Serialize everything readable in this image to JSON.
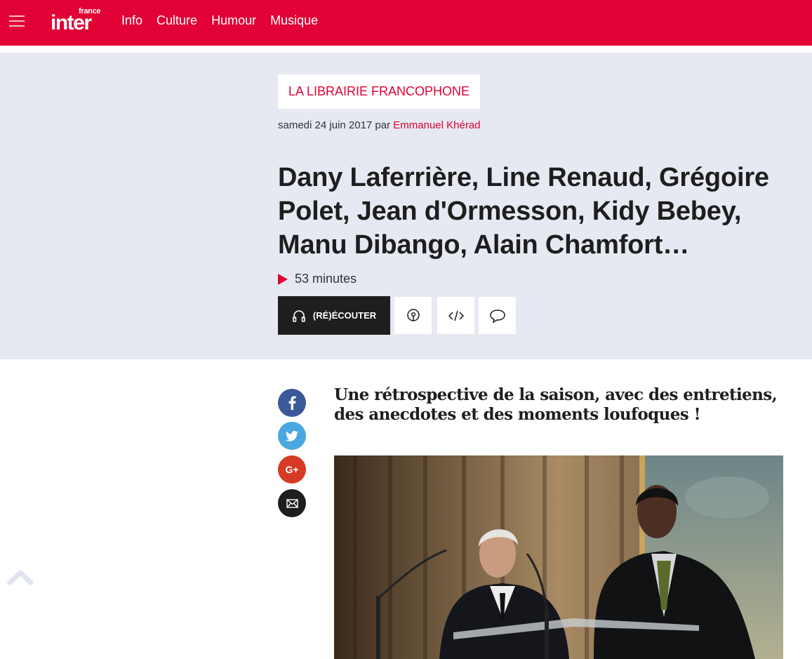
{
  "header": {
    "logo_small": "france",
    "logo_big": "inter",
    "nav": [
      "Info",
      "Culture",
      "Humour",
      "Musique"
    ]
  },
  "article": {
    "kicker": "LA LIBRAIRIE FRANCOPHONE",
    "date_prefix": "samedi 24 juin 2017 par",
    "author": "Emmanuel Khérad",
    "title": "Dany Laferrière, Line Renaud, Grégoire Polet, Jean d'Ormesson, Kidy Bebey, Manu Dibango, Alain Chamfort…",
    "duration": "53 minutes",
    "listen_label": "(RÉ)ÉCOUTER",
    "chapo": "Une rétrospective de la saison, avec des entretiens, des anecdotes et des moments loufoques !"
  },
  "social": {
    "google_label": "G+"
  },
  "colors": {
    "brand": "#e20134",
    "hero_bg": "#e6e9f1",
    "facebook": "#3b5998",
    "twitter": "#4aa7e0",
    "google": "#d63a24",
    "email": "#1e1e1e"
  },
  "icons": [
    "menu-icon",
    "play-icon",
    "headphones-icon",
    "podcast-icon",
    "embed-icon",
    "comment-icon",
    "facebook-icon",
    "twitter-icon",
    "google-plus-icon",
    "email-icon",
    "chevron-up-icon"
  ]
}
